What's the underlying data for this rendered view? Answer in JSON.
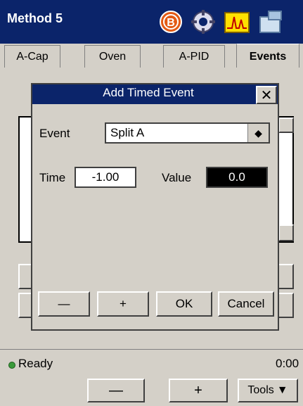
{
  "window": {
    "title": "Method 5"
  },
  "toolbar": {
    "icons": [
      "b-icon",
      "settings-gear-icon",
      "chromatogram-icon",
      "instrument-icon"
    ]
  },
  "tabs": [
    {
      "label": "A-Cap"
    },
    {
      "label": "Oven"
    },
    {
      "label": "A-PID"
    },
    {
      "label": "Events"
    }
  ],
  "dialog": {
    "title": "Add Timed Event",
    "close_label": "✕",
    "event_label": "Event",
    "event_value": "Split A",
    "time_label": "Time",
    "time_value": "-1.00",
    "value_label": "Value",
    "value_value": "0.0",
    "minus_label": "—",
    "plus_label": "+",
    "ok_label": "OK",
    "cancel_label": "Cancel"
  },
  "status": {
    "text": "Ready",
    "time": "0:00"
  },
  "bottom": {
    "minus_label": "—",
    "plus_label": "+",
    "tools_label": "Tools"
  },
  "colors": {
    "titlebar": "#0b246a",
    "status_led": "#3a9a3a"
  }
}
